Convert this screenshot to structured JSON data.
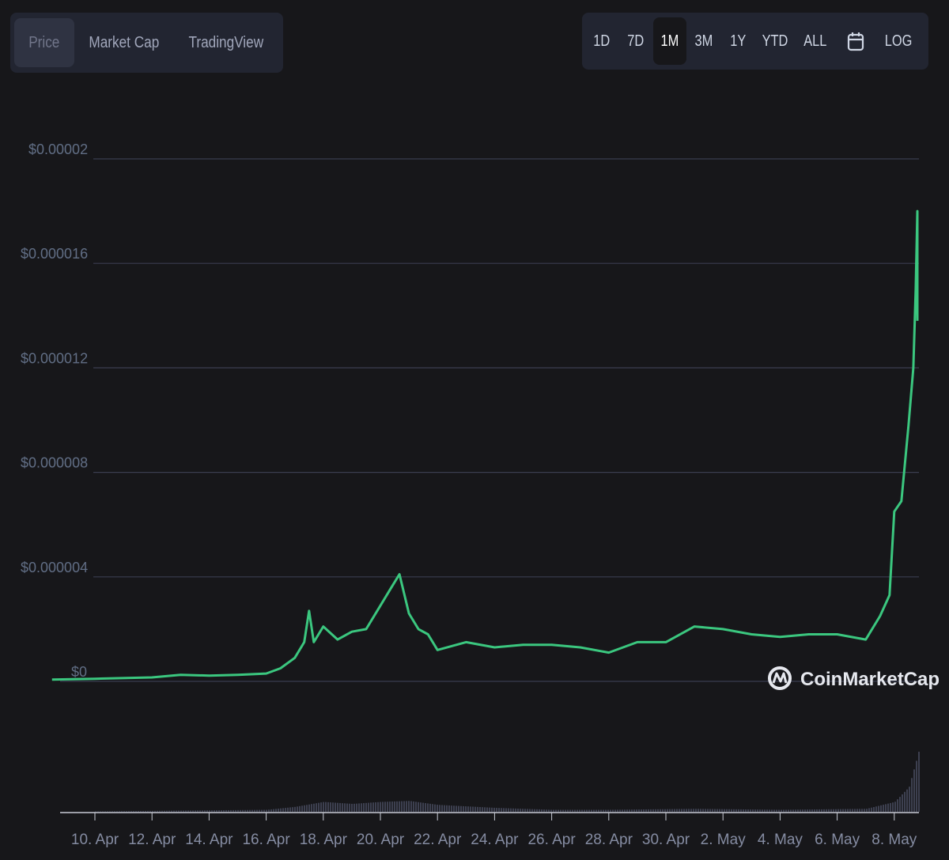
{
  "tabs": [
    {
      "label": "Price",
      "active": true
    },
    {
      "label": "Market Cap",
      "active": false
    },
    {
      "label": "TradingView",
      "active": false
    }
  ],
  "ranges": [
    {
      "label": "1D",
      "active": false
    },
    {
      "label": "7D",
      "active": false
    },
    {
      "label": "1M",
      "active": true
    },
    {
      "label": "3M",
      "active": false
    },
    {
      "label": "1Y",
      "active": false
    },
    {
      "label": "YTD",
      "active": false
    },
    {
      "label": "ALL",
      "active": false
    },
    {
      "label": "calendar-icon",
      "icon": true
    },
    {
      "label": "LOG",
      "active": false
    }
  ],
  "watermark": "CoinMarketCap",
  "colors": {
    "line": "#3bc77f",
    "grid": "#3a3d4f",
    "volume": "#3d4050",
    "background": "#17171a"
  },
  "chart_data": {
    "type": "line",
    "y_ticks": [
      "$0.00002",
      "$0.000016",
      "$0.000012",
      "$0.000008",
      "$0.000004",
      "$0"
    ],
    "ylim": [
      0,
      2e-05
    ],
    "x_ticks": [
      "10. Apr",
      "12. Apr",
      "14. Apr",
      "16. Apr",
      "18. Apr",
      "20. Apr",
      "22. Apr",
      "24. Apr",
      "26. Apr",
      "28. Apr",
      "30. Apr",
      "2. May",
      "4. May",
      "6. May",
      "8. May"
    ],
    "series": [
      {
        "x": [
          "2021-04-08 12:00",
          "2021-04-10",
          "2021-04-12",
          "2021-04-13",
          "2021-04-14",
          "2021-04-15",
          "2021-04-16",
          "2021-04-16 12:00",
          "2021-04-17",
          "2021-04-17 08:00",
          "2021-04-17 12:00",
          "2021-04-17 16:00",
          "2021-04-18",
          "2021-04-18 12:00",
          "2021-04-19",
          "2021-04-19 12:00",
          "2021-04-20",
          "2021-04-20 08:00",
          "2021-04-20 16:00",
          "2021-04-21",
          "2021-04-21 08:00",
          "2021-04-21 16:00",
          "2021-04-22",
          "2021-04-23",
          "2021-04-24",
          "2021-04-25",
          "2021-04-26",
          "2021-04-27",
          "2021-04-28",
          "2021-04-29",
          "2021-04-30",
          "2021-05-01",
          "2021-05-02",
          "2021-05-03",
          "2021-05-04",
          "2021-05-05",
          "2021-05-06",
          "2021-05-07",
          "2021-05-07 12:00",
          "2021-05-07 20:00",
          "2021-05-08",
          "2021-05-08 06:00",
          "2021-05-08 12:00",
          "2021-05-08 16:00",
          "2021-05-08 18:00",
          "2021-05-08 20:00",
          "2021-05-08 22:00",
          "2021-05-09"
        ],
        "y": [
          7e-08,
          1e-07,
          1.5e-07,
          2.5e-07,
          2.2e-07,
          2.5e-07,
          3e-07,
          5e-07,
          9e-07,
          1.5e-06,
          2.7e-06,
          1.5e-06,
          2.1e-06,
          1.6e-06,
          1.9e-06,
          2e-06,
          2.9e-06,
          3.5e-06,
          4.1e-06,
          2.6e-06,
          2e-06,
          1.8e-06,
          1.2e-06,
          1.5e-06,
          1.3e-06,
          1.4e-06,
          1.4e-06,
          1.3e-06,
          1.1e-06,
          1.5e-06,
          1.5e-06,
          2.1e-06,
          2e-06,
          1.8e-06,
          1.7e-06,
          1.8e-06,
          1.8e-06,
          1.6e-06,
          2.5e-06,
          3.3e-06,
          6.5e-06,
          6.9e-06,
          9.8e-06,
          1.2e-05,
          1.5e-05,
          1.8e-05,
          1.5e-05,
          1.38e-05
        ]
      }
    ],
    "volume": {
      "x": [
        "2021-04-08 12:00",
        "2021-04-16",
        "2021-04-17",
        "2021-04-18",
        "2021-04-19",
        "2021-04-20",
        "2021-04-21",
        "2021-04-22",
        "2021-04-24",
        "2021-04-26",
        "2021-04-28",
        "2021-05-01",
        "2021-05-04",
        "2021-05-07",
        "2021-05-08",
        "2021-05-08 12:00",
        "2021-05-08 20:00",
        "2021-05-09"
      ],
      "level": [
        0,
        0.02,
        0.05,
        0.1,
        0.08,
        0.1,
        0.11,
        0.07,
        0.04,
        0.02,
        0.02,
        0.03,
        0.02,
        0.03,
        0.1,
        0.25,
        0.6,
        1.0
      ]
    }
  }
}
